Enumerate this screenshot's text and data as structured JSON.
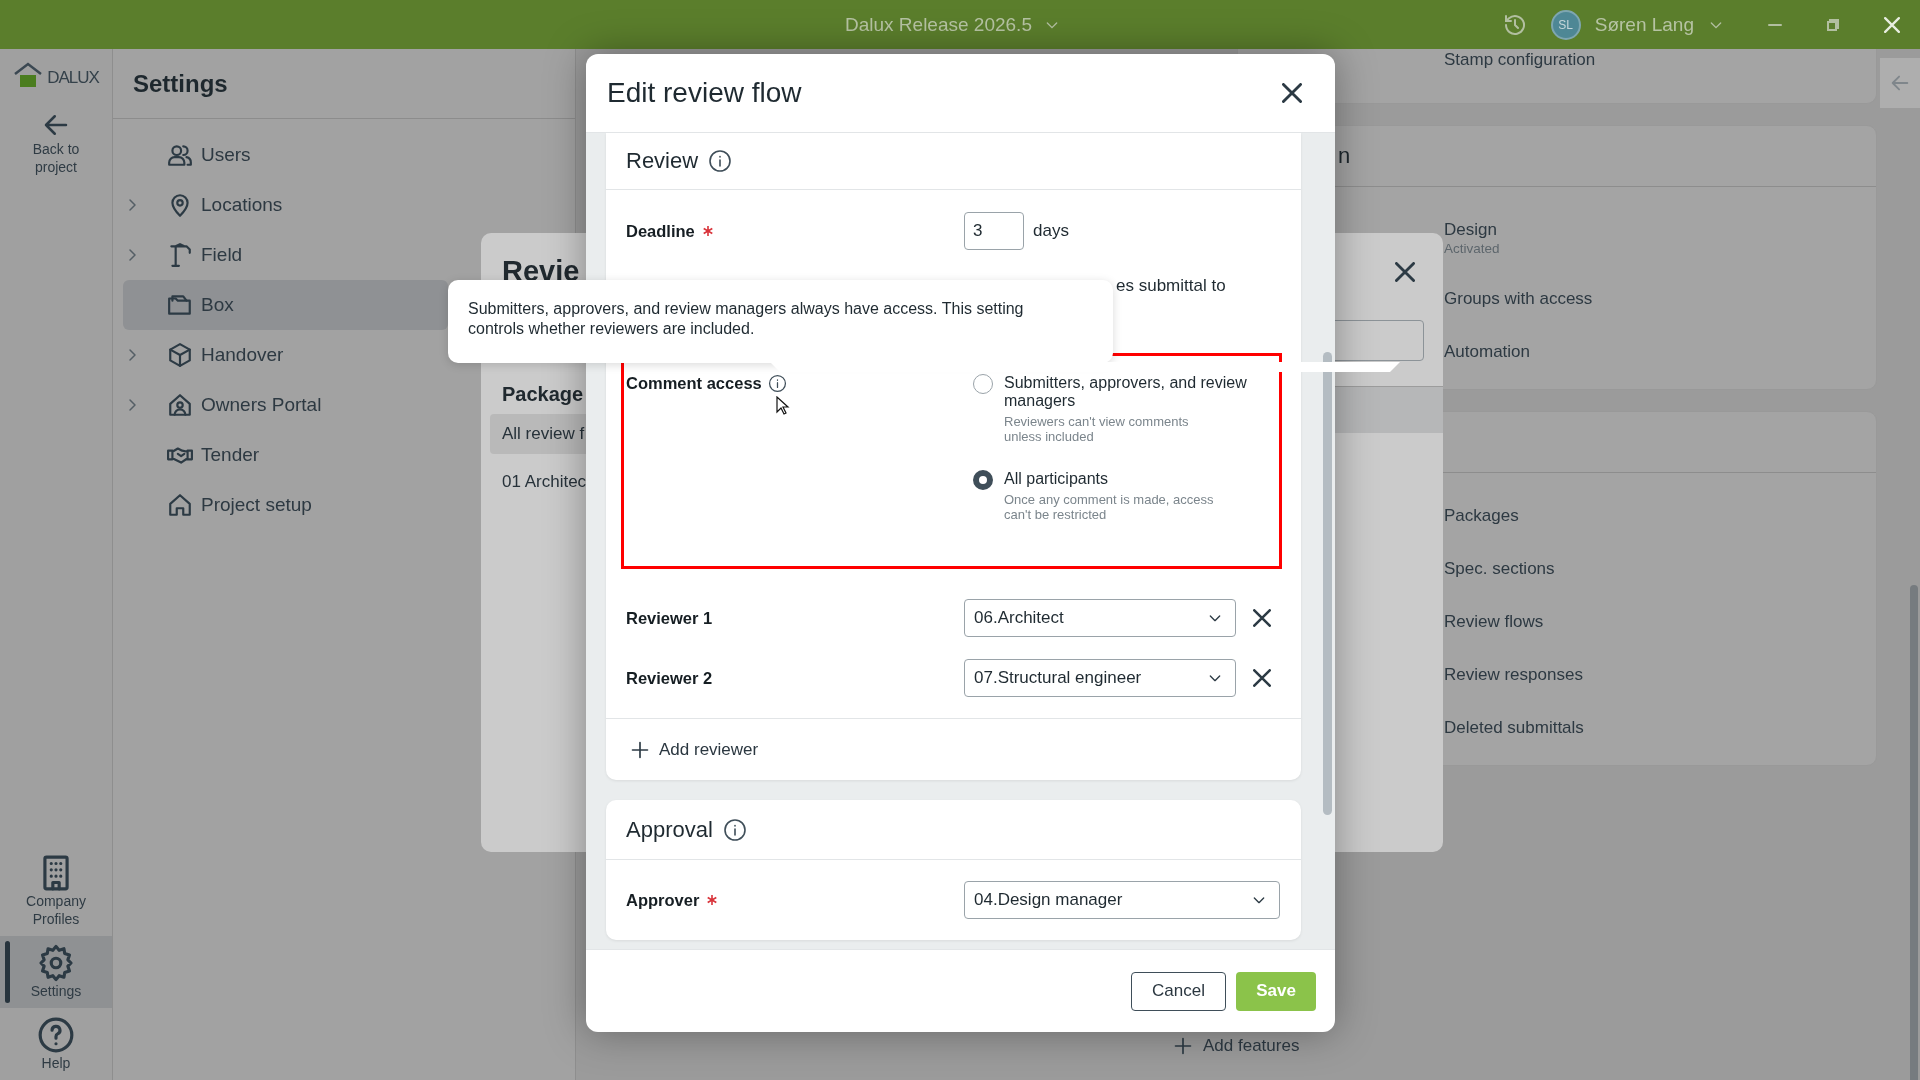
{
  "title_bar": {
    "title": "Dalux Release 2026.5",
    "user_initials": "SL",
    "user_name": "Søren Lang"
  },
  "rail": {
    "logo": "DALUX",
    "back_label": "Back to project",
    "items": [
      {
        "label": "Company Profiles",
        "selected": false
      },
      {
        "label": "Settings",
        "selected": true
      },
      {
        "label": "Help",
        "selected": false
      }
    ]
  },
  "settings_panel": {
    "title": "Settings",
    "items": [
      {
        "label": "Users",
        "expandable": false,
        "selected": false
      },
      {
        "label": "Locations",
        "expandable": true,
        "selected": false
      },
      {
        "label": "Field",
        "expandable": true,
        "selected": false
      },
      {
        "label": "Box",
        "expandable": false,
        "selected": true
      },
      {
        "label": "Handover",
        "expandable": true,
        "selected": false
      },
      {
        "label": "Owners Portal",
        "expandable": true,
        "selected": false
      },
      {
        "label": "Tender",
        "expandable": false,
        "selected": false
      },
      {
        "label": "Project setup",
        "expandable": false,
        "selected": false
      }
    ]
  },
  "feature_cards": [
    {
      "items": [
        {
          "label": "Stamp configuration"
        }
      ]
    },
    {
      "heading": "n",
      "items": [
        {
          "label": "Design",
          "status": "Activated"
        },
        {
          "label": "Groups with access"
        },
        {
          "label": "Automation"
        }
      ]
    },
    {
      "items": [
        {
          "label": "Packages"
        },
        {
          "label": "Spec. sections"
        },
        {
          "label": "Review flows"
        },
        {
          "label": "Review responses"
        },
        {
          "label": "Deleted submittals"
        }
      ]
    }
  ],
  "add_features": "Add features",
  "background_dialog": {
    "title": "Revie",
    "package_heading": "Package",
    "packages": [
      {
        "label": "All review f",
        "selected": true
      },
      {
        "label": "01 Architec",
        "selected": false
      }
    ]
  },
  "modal": {
    "title": "Edit review flow",
    "review": {
      "heading": "Review",
      "deadline": {
        "label": "Deadline",
        "required": true,
        "value": "3",
        "unit": "days"
      },
      "partial_text": "es submittal to",
      "comment_access": {
        "label": "Comment access",
        "highlighted": true,
        "options": [
          {
            "label": "Submitters, approvers, and review managers",
            "description": "Reviewers can't view comments unless included",
            "selected": false
          },
          {
            "label": "All participants",
            "description": "Once any comment is made, access can't be restricted",
            "selected": true
          }
        ]
      },
      "reviewers": [
        {
          "label": "Reviewer 1",
          "value": "06.Architect"
        },
        {
          "label": "Reviewer 2",
          "value": "07.Structural engineer"
        }
      ],
      "add_reviewer": "Add reviewer"
    },
    "approval": {
      "heading": "Approval",
      "approver": {
        "label": "Approver",
        "required": true,
        "value": "04.Design manager"
      }
    },
    "buttons": [
      {
        "label": "Cancel",
        "kind": "secondary"
      },
      {
        "label": "Save",
        "kind": "primary"
      }
    ]
  },
  "tooltip": {
    "text": "Submitters, approvers, and review managers always have access. This setting controls whether reviewers are included."
  }
}
